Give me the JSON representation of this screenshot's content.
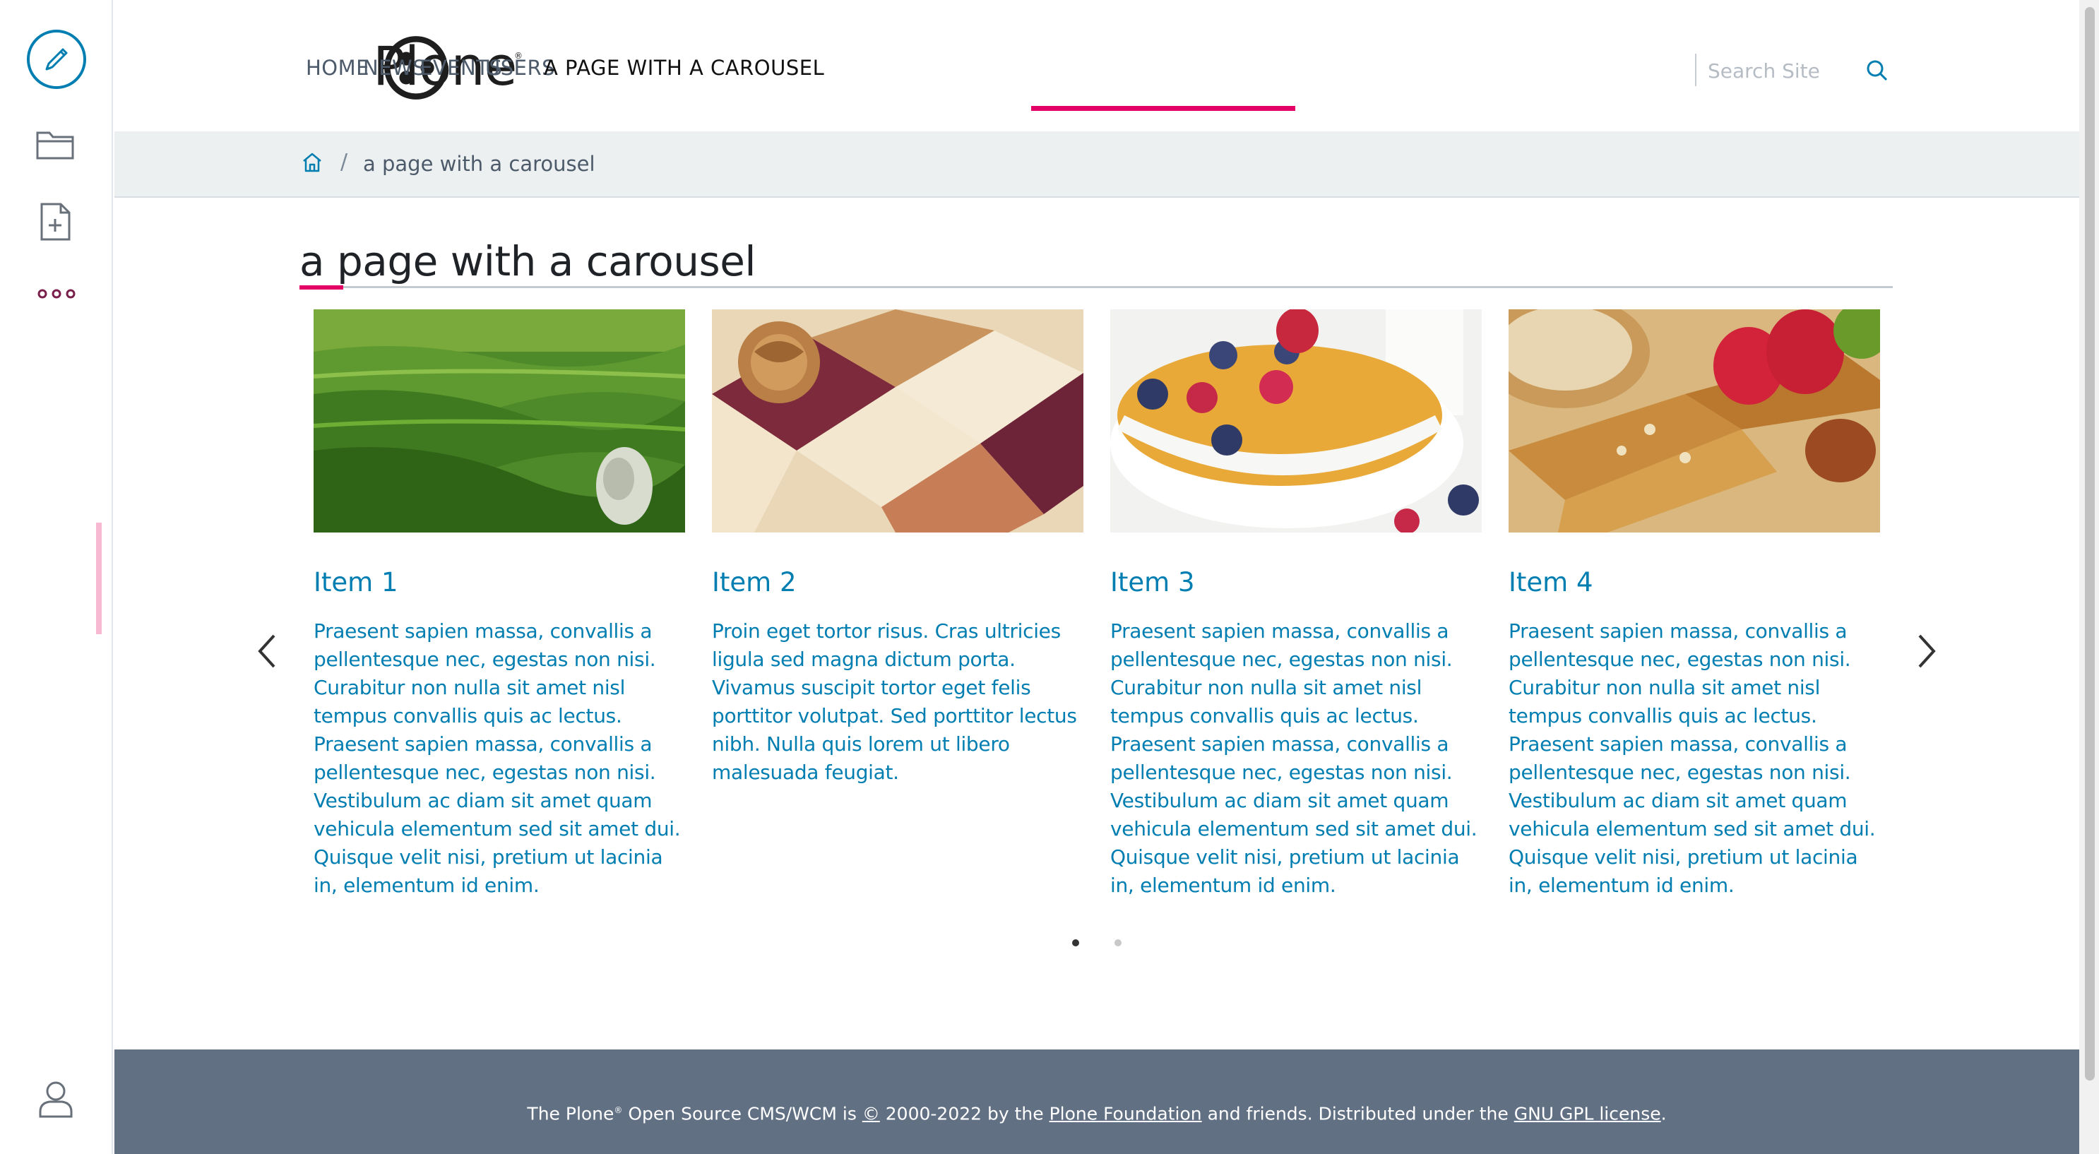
{
  "toolbar": {
    "items": [
      {
        "icon": "pencil-icon",
        "label": "Edit"
      },
      {
        "icon": "folder-icon",
        "label": "Contents"
      },
      {
        "icon": "add-document-icon",
        "label": "Add"
      },
      {
        "icon": "more-icon",
        "label": "More"
      },
      {
        "icon": "user-icon",
        "label": "Personal tools"
      }
    ]
  },
  "header": {
    "logo_text": "Plone",
    "logo_mark": "®",
    "nav": [
      {
        "label": "HOME",
        "active": false
      },
      {
        "label": "NEWS",
        "active": false
      },
      {
        "label": "EVENTS",
        "active": false
      },
      {
        "label": "USERS",
        "active": false
      },
      {
        "label": "A PAGE WITH A CAROUSEL",
        "active": true
      }
    ],
    "search_placeholder": "Search Site",
    "accent_color": "#e40166"
  },
  "breadcrumb": {
    "separator": "/",
    "current": "a page with a carousel"
  },
  "page": {
    "title": "a page with a carousel"
  },
  "carousel": {
    "items": [
      {
        "title": "Item 1",
        "image": "tea-plantation-image",
        "text": "Praesent sapien massa, convallis a pellentesque nec, egestas non nisi. Curabitur non nulla sit amet nisl tempus convallis quis ac lectus. Praesent sapien massa, convallis a pellentesque nec, egestas non nisi. Vestibulum ac diam sit amet quam vehicula elementum sed sit amet dui. Quisque velit nisi, pretium ut lacinia in, elementum id enim."
      },
      {
        "title": "Item 2",
        "image": "walnut-bars-image",
        "text": "Proin eget tortor risus. Cras ultricies ligula sed magna dictum porta. Vivamus suscipit tortor eget felis porttitor volutpat. Sed porttitor lectus nibh. Nulla quis lorem ut libero malesuada feugiat."
      },
      {
        "title": "Item 3",
        "image": "cereal-bowl-image",
        "text": "Praesent sapien massa, convallis a pellentesque nec, egestas non nisi. Curabitur non nulla sit amet nisl tempus convallis quis ac lectus. Praesent sapien massa, convallis a pellentesque nec, egestas non nisi. Vestibulum ac diam sit amet quam vehicula elementum sed sit amet dui. Quisque velit nisi, pretium ut lacinia in, elementum id enim."
      },
      {
        "title": "Item 4",
        "image": "granola-bars-image",
        "text": "Praesent sapien massa, convallis a pellentesque nec, egestas non nisi. Curabitur non nulla sit amet nisl tempus convallis quis ac lectus. Praesent sapien massa, convallis a pellentesque nec, egestas non nisi. Vestibulum ac diam sit amet quam vehicula elementum sed sit amet dui. Quisque velit nisi, pretium ut lacinia in, elementum id enim."
      }
    ],
    "pages": 2,
    "active_page": 1
  },
  "footer": {
    "pre": "The Plone",
    "reg": "®",
    "mid1": " Open Source CMS/WCM is ",
    "copy": "©",
    "mid2": " 2000-2022 by the ",
    "link1": "Plone Foundation",
    "mid3": " and friends. Distributed under the ",
    "link2": "GNU GPL license",
    "end": "."
  }
}
